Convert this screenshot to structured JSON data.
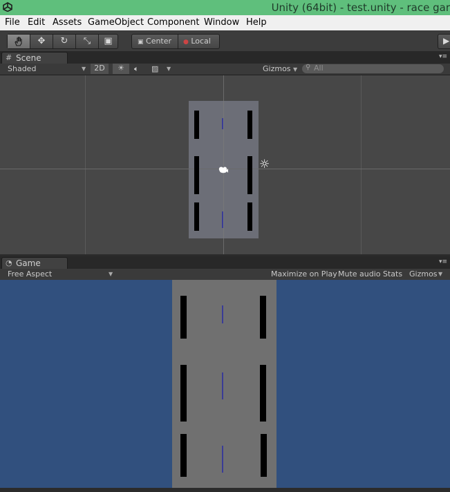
{
  "window": {
    "title": "Unity (64bit) - test.unity - race gar"
  },
  "menu": [
    "File",
    "Edit",
    "Assets",
    "GameObject",
    "Component",
    "Window",
    "Help"
  ],
  "toolbar": {
    "tools": [
      "hand-tool",
      "move-tool",
      "rotate-tool",
      "scale-tool",
      "rect-tool"
    ],
    "pivot": "Center",
    "space": "Local"
  },
  "scene": {
    "tab_label": "Scene",
    "shading_mode": "Shaded",
    "mode_2d": "2D",
    "gizmos": "Gizmos",
    "search_placeholder": "All"
  },
  "game": {
    "tab_label": "Game",
    "aspect": "Free Aspect",
    "maximize_on_play": "Maximize on Play",
    "mute_audio": "Mute audio",
    "stats": "Stats",
    "gizmos": "Gizmos"
  },
  "colors": {
    "title_bar": "#5fbf7c",
    "camera_background": "#31507e",
    "road": "#707070",
    "lane_marking": "#3a3c96"
  }
}
